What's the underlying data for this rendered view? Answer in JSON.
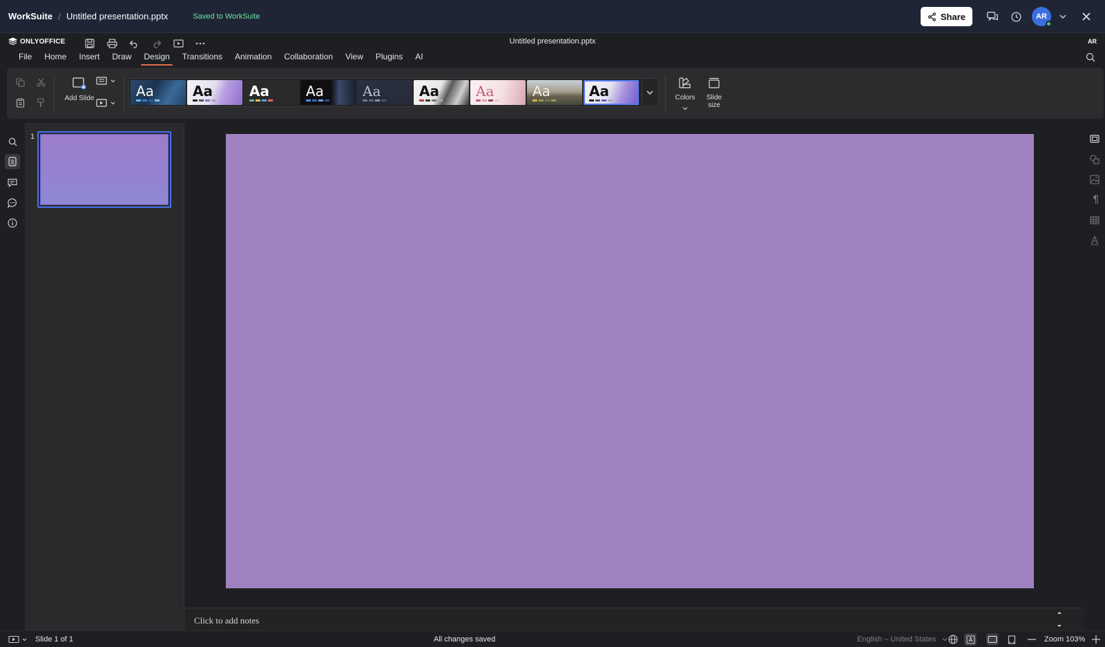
{
  "topbar": {
    "brand": "WorkSuite",
    "separator": "/",
    "doc_title": "Untitled presentation.pptx",
    "saved_status": "Saved to WorkSuite",
    "share_label": "Share",
    "avatar_initials": "AR"
  },
  "editor": {
    "logo_text": "ONLYOFFICE",
    "title": "Untitled presentation.pptx",
    "user_initials": "AR",
    "menu_tabs": [
      "File",
      "Home",
      "Insert",
      "Draw",
      "Design",
      "Transitions",
      "Animation",
      "Collaboration",
      "View",
      "Plugins",
      "AI"
    ],
    "active_tab": "Design"
  },
  "ribbon": {
    "add_slide_label": "Add Slide",
    "colors_label": "Colors",
    "slide_size_label": "Slide size",
    "theme_sample_text": "Aa"
  },
  "thumbnails": {
    "slide_number": "1"
  },
  "notes": {
    "placeholder": "Click to add notes"
  },
  "statusbar": {
    "slide_counter": "Slide 1 of 1",
    "save_status": "All changes saved",
    "language": "English – United States",
    "zoom": "Zoom 103%"
  },
  "colors": {
    "slide_background": "#9f82c0",
    "selection_blue": "#4a6ff0",
    "active_tab_underline": "#e27052",
    "saved_green": "#6ee7a8"
  }
}
